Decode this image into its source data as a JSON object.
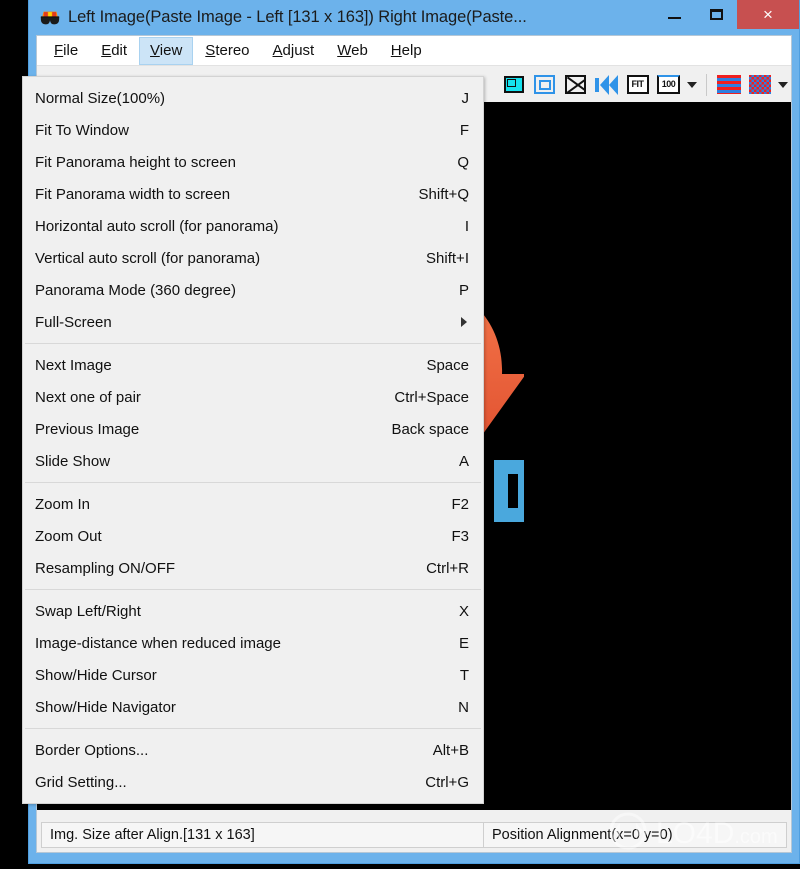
{
  "window": {
    "title": "Left Image(Paste Image - Left [131 x 163]) Right Image(Paste...",
    "icon": "3d-glasses-icon",
    "accent_titlebar": "#6cb2eb",
    "close_button_color": "#c75050",
    "controls": {
      "minimize": "minimize-icon",
      "maximize": "maximize-icon",
      "close": "×"
    }
  },
  "menubar": {
    "items": [
      {
        "label": "File",
        "accel": "F",
        "active": false
      },
      {
        "label": "Edit",
        "accel": "E",
        "active": false
      },
      {
        "label": "View",
        "accel": "V",
        "active": true
      },
      {
        "label": "Stereo",
        "accel": "S",
        "active": false
      },
      {
        "label": "Adjust",
        "accel": "A",
        "active": false
      },
      {
        "label": "Web",
        "accel": "W",
        "active": false
      },
      {
        "label": "Help",
        "accel": "H",
        "active": false
      }
    ]
  },
  "view_menu": {
    "groups": [
      {
        "items": [
          {
            "label": "Normal Size(100%)",
            "accel": "J"
          },
          {
            "label": "Fit To Window",
            "accel": "F"
          },
          {
            "label": "Fit Panorama height to screen",
            "accel": "Q"
          },
          {
            "label": "Fit Panorama width to screen",
            "accel": "Shift+Q"
          },
          {
            "label": "Horizontal auto scroll (for panorama)",
            "accel": "I"
          },
          {
            "label": "Vertical auto scroll (for panorama)",
            "accel": "Shift+I"
          },
          {
            "label": "Panorama Mode (360 degree)",
            "accel": "P"
          },
          {
            "label": "Full-Screen",
            "accel": "",
            "submenu": true
          }
        ]
      },
      {
        "items": [
          {
            "label": "Next Image",
            "accel": "Space"
          },
          {
            "label": "Next one of pair",
            "accel": "Ctrl+Space"
          },
          {
            "label": "Previous Image",
            "accel": "Back space"
          },
          {
            "label": "Slide Show",
            "accel": "A"
          }
        ]
      },
      {
        "items": [
          {
            "label": "Zoom In",
            "accel": "F2"
          },
          {
            "label": "Zoom Out",
            "accel": "F3"
          },
          {
            "label": "Resampling ON/OFF",
            "accel": "Ctrl+R"
          }
        ]
      },
      {
        "items": [
          {
            "label": "Swap Left/Right",
            "accel": "X"
          },
          {
            "label": "Image-distance when reduced image",
            "accel": "E"
          },
          {
            "label": "Show/Hide Cursor",
            "accel": "T"
          },
          {
            "label": "Show/Hide Navigator",
            "accel": "N"
          }
        ]
      },
      {
        "items": [
          {
            "label": "Border Options...",
            "accel": "Alt+B"
          },
          {
            "label": "Grid Setting...",
            "accel": "Ctrl+G"
          }
        ]
      }
    ]
  },
  "toolbar": {
    "buttons": [
      {
        "name": "fill-view-icon",
        "label": ""
      },
      {
        "name": "frame-view-icon",
        "label": ""
      },
      {
        "name": "expand-view-icon",
        "label": ""
      },
      {
        "name": "align-left-icon",
        "label": ""
      },
      {
        "name": "fit-zoom-icon",
        "label": "FIT"
      },
      {
        "name": "hundred-zoom-icon",
        "label": "100"
      }
    ],
    "zoom_dropdown_caret": "chevron-down-icon",
    "stereo_modes": [
      {
        "name": "interlaced-stripes-icon"
      },
      {
        "name": "checkerboard-icon"
      }
    ],
    "stereo_dropdown_caret": "chevron-down-icon"
  },
  "statusbar": {
    "left": "Img. Size after Align.[131 x 163]",
    "right": "Position Alignment(x=0 y=0)"
  },
  "canvas": {
    "background": "#000000",
    "logo_alt": "lo4d-refresh-arrows-logo",
    "logo_text": ".O4D",
    "logo_colors": {
      "blue_arrow": "#4f93d4",
      "orange_arrow": "#ed6a3d",
      "yellow_disc": "#ffcc00",
      "text_blue": "#4aa8dd"
    }
  },
  "watermark": {
    "text": "LO4D.com"
  }
}
